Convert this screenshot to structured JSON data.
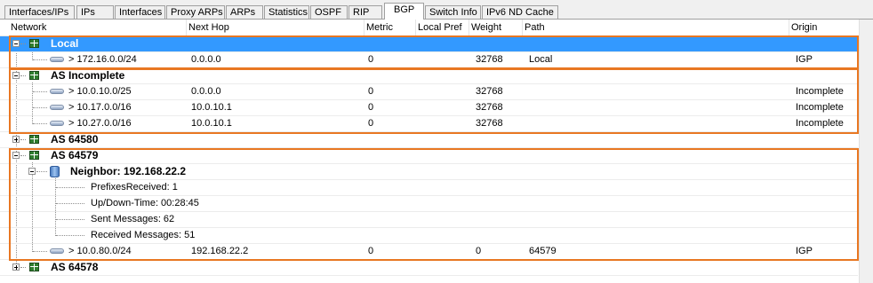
{
  "tabs": [
    "Interfaces/IPs",
    "IPs",
    "Interfaces",
    "Proxy ARPs",
    "ARPs",
    "Statistics",
    "OSPF",
    "RIP",
    "BGP",
    "Switch Info",
    "IPv6 ND Cache"
  ],
  "active_tab": "BGP",
  "columns": {
    "network": "Network",
    "next_hop": "Next Hop",
    "metric": "Metric",
    "local_pref": "Local Pref",
    "weight": "Weight",
    "path": "Path",
    "origin": "Origin"
  },
  "groups": {
    "local": {
      "label": "Local",
      "routes": [
        {
          "network": "> 172.16.0.0/24",
          "next_hop": "0.0.0.0",
          "metric": "0",
          "weight": "32768",
          "path": "Local",
          "origin": "IGP"
        }
      ]
    },
    "incomplete": {
      "label": "AS Incomplete",
      "routes": [
        {
          "network": "> 10.0.10.0/25",
          "next_hop": "0.0.0.0",
          "metric": "0",
          "weight": "32768",
          "path": "",
          "origin": "Incomplete"
        },
        {
          "network": "> 10.17.0.0/16",
          "next_hop": "10.0.10.1",
          "metric": "0",
          "weight": "32768",
          "path": "",
          "origin": "Incomplete"
        },
        {
          "network": "> 10.27.0.0/16",
          "next_hop": "10.0.10.1",
          "metric": "0",
          "weight": "32768",
          "path": "",
          "origin": "Incomplete"
        }
      ]
    },
    "as64580": {
      "label": "AS 64580"
    },
    "as64579": {
      "label": "AS 64579",
      "neighbor": {
        "label": "Neighbor: 192.168.22.2",
        "details": [
          "PrefixesReceived: 1",
          "Up/Down-Time: 00:28:45",
          "Sent Messages: 62",
          "Received Messages: 51"
        ]
      },
      "routes": [
        {
          "network": "> 10.0.80.0/24",
          "next_hop": "192.168.22.2",
          "metric": "0",
          "weight": "0",
          "path": "64579",
          "origin": "IGP"
        }
      ]
    },
    "as64578": {
      "label": "AS 64578"
    }
  },
  "colors": {
    "selection": "#3399ff",
    "highlight_box": "#e87722",
    "table_icon": "#2f7d2f"
  }
}
